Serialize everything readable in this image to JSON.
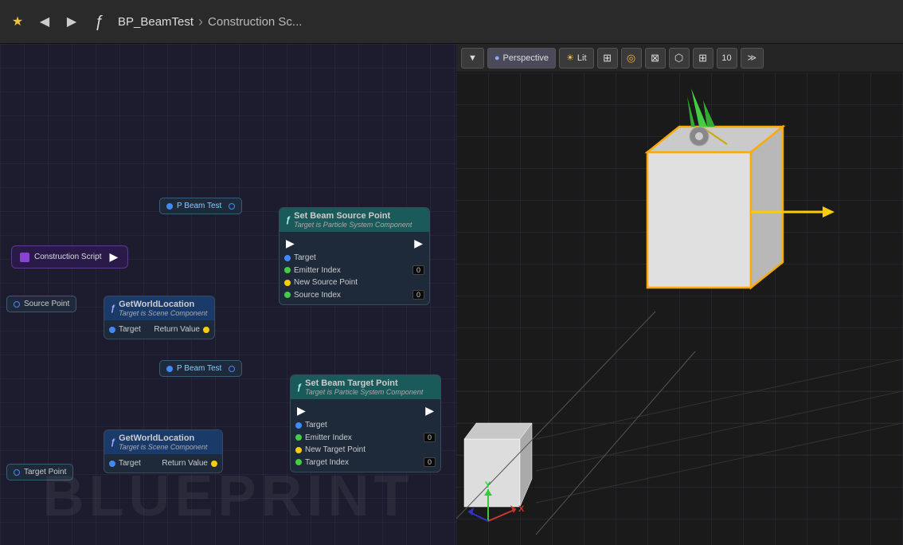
{
  "toolbar": {
    "star_label": "★",
    "back_label": "◀",
    "forward_label": "▶",
    "function_icon": "ƒ",
    "breadcrumb": {
      "project": "BP_BeamTest",
      "separator": "›",
      "current": "Construction Sc..."
    }
  },
  "viewport": {
    "perspective_label": "Perspective",
    "lit_label": "Lit",
    "num_label": "10",
    "more_btn": "≫"
  },
  "blueprint": {
    "watermark": "BLUEPRINT",
    "nodes": {
      "construction_script": "Construction Script",
      "set_beam_source_title": "Set Beam Source Point",
      "set_beam_source_subtitle": "Target is Particle System Component",
      "set_beam_target_title": "Set Beam Target Point",
      "set_beam_target_subtitle": "Target is Particle System Component",
      "get_world_location_title": "GetWorldLocation",
      "get_world_location_subtitle": "Target is Scene Component",
      "p_beam_test": "P Beam Test",
      "source_point": "Source Point",
      "target_point": "Target Point",
      "pins": {
        "target": "Target",
        "emitter_index": "Emitter Index",
        "new_source_point": "New Source Point",
        "source_index": "Source Index",
        "return_value": "Return Value",
        "new_target_point": "New Target Point",
        "target_index": "Target Index"
      },
      "pin_values": {
        "zero": "0"
      }
    }
  }
}
